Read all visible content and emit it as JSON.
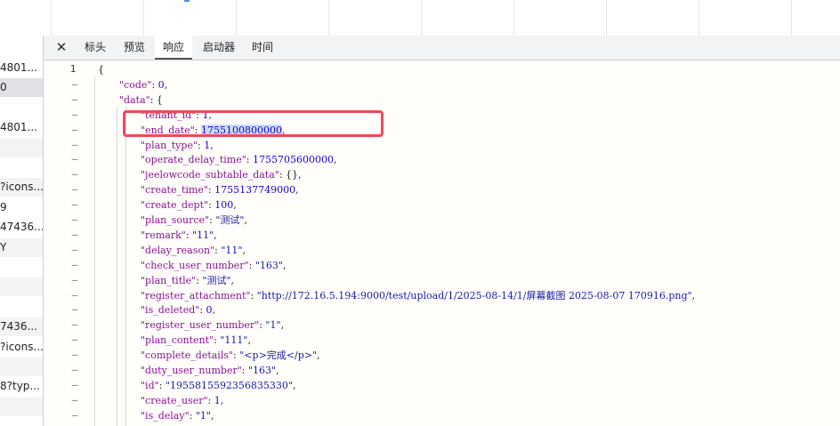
{
  "tabs": [
    {
      "label": "标头"
    },
    {
      "label": "预览"
    },
    {
      "label": "响应"
    },
    {
      "label": "启动器"
    },
    {
      "label": "时间"
    }
  ],
  "left_list": [
    "4801...",
    "0",
    "",
    "4801...",
    "",
    "",
    "?icons...",
    "9",
    "47436...",
    "Y",
    "",
    "",
    "",
    "7436...",
    "?icons...",
    "",
    "8?typ...",
    "",
    ""
  ],
  "code_lines": [
    {
      "indent": 0,
      "parts": [
        {
          "t": "p",
          "v": "{"
        }
      ]
    },
    {
      "indent": 1,
      "parts": [
        {
          "t": "k",
          "v": "\"code\""
        },
        {
          "t": "p",
          "v": ": "
        },
        {
          "t": "n",
          "v": "0"
        },
        {
          "t": "p",
          "v": ","
        }
      ]
    },
    {
      "indent": 1,
      "parts": [
        {
          "t": "k",
          "v": "\"data\""
        },
        {
          "t": "p",
          "v": ": {"
        }
      ]
    },
    {
      "indent": 2,
      "parts": [
        {
          "t": "k",
          "v": "\"tenant_id\""
        },
        {
          "t": "p",
          "v": ": "
        },
        {
          "t": "n",
          "v": "1"
        },
        {
          "t": "p",
          "v": ","
        }
      ]
    },
    {
      "indent": 2,
      "parts": [
        {
          "t": "k",
          "v": "\"end_date\""
        },
        {
          "t": "p",
          "v": ": "
        },
        {
          "t": "nh",
          "v": "1755100800000"
        },
        {
          "t": "p",
          "v": ","
        }
      ]
    },
    {
      "indent": 2,
      "parts": [
        {
          "t": "k",
          "v": "\"plan_type\""
        },
        {
          "t": "p",
          "v": ": "
        },
        {
          "t": "n",
          "v": "1"
        },
        {
          "t": "p",
          "v": ","
        }
      ]
    },
    {
      "indent": 2,
      "parts": [
        {
          "t": "k",
          "v": "\"operate_delay_time\""
        },
        {
          "t": "p",
          "v": ": "
        },
        {
          "t": "n",
          "v": "1755705600000"
        },
        {
          "t": "p",
          "v": ","
        }
      ]
    },
    {
      "indent": 2,
      "parts": [
        {
          "t": "k",
          "v": "\"jeelowcode_subtable_data\""
        },
        {
          "t": "p",
          "v": ": {},"
        }
      ]
    },
    {
      "indent": 2,
      "parts": [
        {
          "t": "k",
          "v": "\"create_time\""
        },
        {
          "t": "p",
          "v": ": "
        },
        {
          "t": "n",
          "v": "1755137749000"
        },
        {
          "t": "p",
          "v": ","
        }
      ]
    },
    {
      "indent": 2,
      "parts": [
        {
          "t": "k",
          "v": "\"create_dept\""
        },
        {
          "t": "p",
          "v": ": "
        },
        {
          "t": "n",
          "v": "100"
        },
        {
          "t": "p",
          "v": ","
        }
      ]
    },
    {
      "indent": 2,
      "parts": [
        {
          "t": "k",
          "v": "\"plan_source\""
        },
        {
          "t": "p",
          "v": ": "
        },
        {
          "t": "s",
          "v": "\"测试\""
        },
        {
          "t": "p",
          "v": ","
        }
      ]
    },
    {
      "indent": 2,
      "parts": [
        {
          "t": "k",
          "v": "\"remark\""
        },
        {
          "t": "p",
          "v": ": "
        },
        {
          "t": "s",
          "v": "\"11\""
        },
        {
          "t": "p",
          "v": ","
        }
      ]
    },
    {
      "indent": 2,
      "parts": [
        {
          "t": "k",
          "v": "\"delay_reason\""
        },
        {
          "t": "p",
          "v": ": "
        },
        {
          "t": "s",
          "v": "\"11\""
        },
        {
          "t": "p",
          "v": ","
        }
      ]
    },
    {
      "indent": 2,
      "parts": [
        {
          "t": "k",
          "v": "\"check_user_number\""
        },
        {
          "t": "p",
          "v": ": "
        },
        {
          "t": "s",
          "v": "\"163\""
        },
        {
          "t": "p",
          "v": ","
        }
      ]
    },
    {
      "indent": 2,
      "parts": [
        {
          "t": "k",
          "v": "\"plan_title\""
        },
        {
          "t": "p",
          "v": ": "
        },
        {
          "t": "s",
          "v": "\"测试\""
        },
        {
          "t": "p",
          "v": ","
        }
      ]
    },
    {
      "indent": 2,
      "parts": [
        {
          "t": "k",
          "v": "\"register_attachment\""
        },
        {
          "t": "p",
          "v": ": "
        },
        {
          "t": "s",
          "v": "\"http://172.16.5.194:9000/test/upload/1/2025-08-14/1/屏幕截图 2025-08-07 170916.png\""
        },
        {
          "t": "p",
          "v": ","
        }
      ]
    },
    {
      "indent": 2,
      "parts": [
        {
          "t": "k",
          "v": "\"is_deleted\""
        },
        {
          "t": "p",
          "v": ": "
        },
        {
          "t": "n",
          "v": "0"
        },
        {
          "t": "p",
          "v": ","
        }
      ]
    },
    {
      "indent": 2,
      "parts": [
        {
          "t": "k",
          "v": "\"register_user_number\""
        },
        {
          "t": "p",
          "v": ": "
        },
        {
          "t": "s",
          "v": "\"1\""
        },
        {
          "t": "p",
          "v": ","
        }
      ]
    },
    {
      "indent": 2,
      "parts": [
        {
          "t": "k",
          "v": "\"plan_content\""
        },
        {
          "t": "p",
          "v": ": "
        },
        {
          "t": "s",
          "v": "\"111\""
        },
        {
          "t": "p",
          "v": ","
        }
      ]
    },
    {
      "indent": 2,
      "parts": [
        {
          "t": "k",
          "v": "\"complete_details\""
        },
        {
          "t": "p",
          "v": ": "
        },
        {
          "t": "s",
          "v": "\"<p>完成</p>\""
        },
        {
          "t": "p",
          "v": ","
        }
      ]
    },
    {
      "indent": 2,
      "parts": [
        {
          "t": "k",
          "v": "\"duty_user_number\""
        },
        {
          "t": "p",
          "v": ": "
        },
        {
          "t": "s",
          "v": "\"163\""
        },
        {
          "t": "p",
          "v": ","
        }
      ]
    },
    {
      "indent": 2,
      "parts": [
        {
          "t": "k",
          "v": "\"id\""
        },
        {
          "t": "p",
          "v": ": "
        },
        {
          "t": "s",
          "v": "\"1955815592356835330\""
        },
        {
          "t": "p",
          "v": ","
        }
      ]
    },
    {
      "indent": 2,
      "parts": [
        {
          "t": "k",
          "v": "\"create_user\""
        },
        {
          "t": "p",
          "v": ": "
        },
        {
          "t": "n",
          "v": "1"
        },
        {
          "t": "p",
          "v": ","
        }
      ]
    },
    {
      "indent": 2,
      "parts": [
        {
          "t": "k",
          "v": "\"is_delay\""
        },
        {
          "t": "p",
          "v": ": "
        },
        {
          "t": "s",
          "v": "\"1\""
        },
        {
          "t": "p",
          "v": ","
        }
      ]
    }
  ],
  "gutter_first": "1",
  "gutter_dash": "–",
  "colors": {
    "highlight_box": "#f0485c",
    "selection": "#c8ddf5"
  }
}
